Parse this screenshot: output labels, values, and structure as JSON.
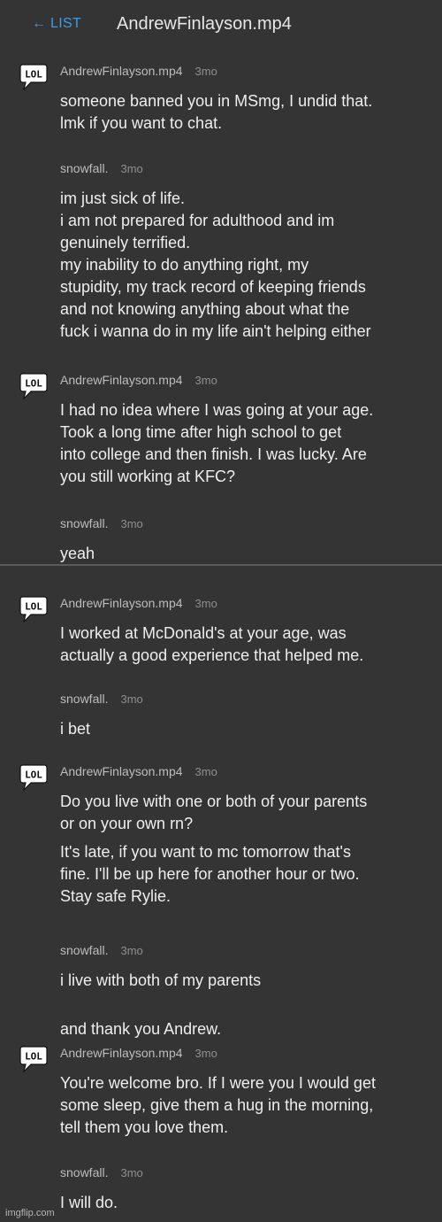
{
  "header": {
    "back_label": "← LIST",
    "title": "AndrewFinlayson.mp4"
  },
  "avatar_text": "LOL",
  "messages": [
    {
      "author": "AndrewFinlayson.mp4",
      "time": "3mo",
      "lines": [
        "someone banned you in MSmg, I undid that.\nlmk if you want to chat."
      ]
    },
    {
      "author": "snowfall.",
      "time": "3mo",
      "lines": [
        "im just sick of life.\ni am not prepared for adulthood and im\ngenuinely terrified.\nmy inability to do anything right, my\nstupidity, my track record of keeping friends\nand not knowing anything about what the\nfuck i wanna do in my life ain't helping either"
      ]
    },
    {
      "author": "AndrewFinlayson.mp4",
      "time": "3mo",
      "lines": [
        "I had no idea where I was going at your age.\nTook a long time after high school to get\ninto college and then finish. I was lucky. Are\nyou still working at KFC?"
      ]
    },
    {
      "author": "snowfall.",
      "time": "3mo",
      "lines": [
        "yeah"
      ]
    },
    {
      "author": "AndrewFinlayson.mp4",
      "time": "3mo",
      "lines": [
        "I worked at McDonald's at your age, was\nactually a good experience that helped me."
      ]
    },
    {
      "author": "snowfall.",
      "time": "3mo",
      "lines": [
        "i bet"
      ]
    },
    {
      "author": "AndrewFinlayson.mp4",
      "time": "3mo",
      "lines": [
        "Do you live with one or both of your parents\nor on your own rn?",
        "It's late, if you want to mc tomorrow that's\nfine. I'll be up here for another hour or two.\nStay safe Rylie."
      ]
    },
    {
      "author": "snowfall.",
      "time": "3mo",
      "lines": [
        "i live with both of my parents",
        "and thank you Andrew."
      ]
    },
    {
      "author": "AndrewFinlayson.mp4",
      "time": "3mo",
      "lines": [
        "You're welcome bro. If I were you I would get\nsome sleep, give them a hug in the morning,\ntell them you love them."
      ]
    },
    {
      "author": "snowfall.",
      "time": "3mo",
      "lines": [
        "I will do."
      ]
    }
  ],
  "watermark": "imgflip.com"
}
